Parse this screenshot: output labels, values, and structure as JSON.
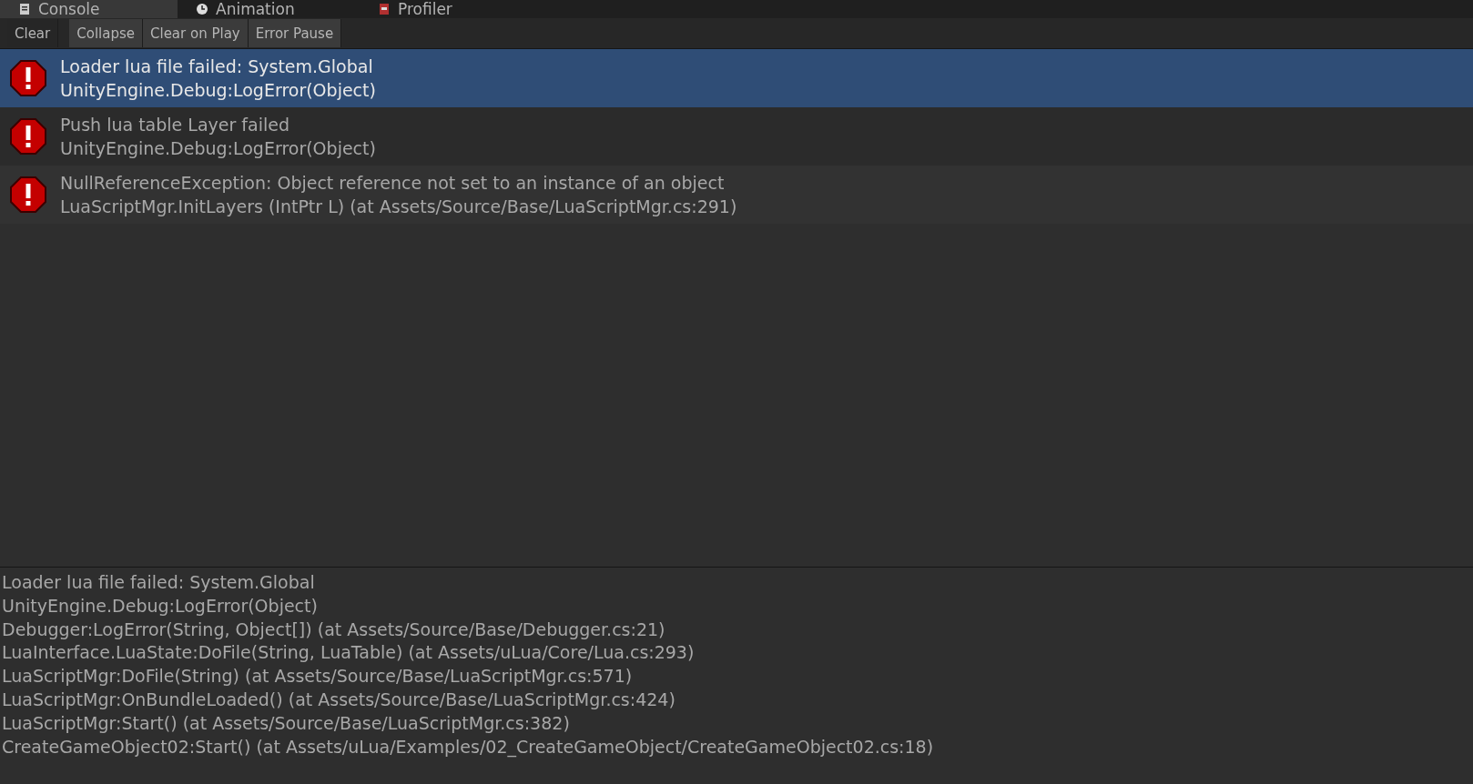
{
  "tabs": [
    {
      "label": "Console",
      "selected": true
    },
    {
      "label": "Animation",
      "selected": false
    },
    {
      "label": "Profiler",
      "selected": false
    }
  ],
  "toolbar": [
    {
      "label": "Clear",
      "kind": "button"
    },
    {
      "label": "Collapse",
      "kind": "toggle"
    },
    {
      "label": "Clear on Play",
      "kind": "toggle"
    },
    {
      "label": "Error Pause",
      "kind": "toggle"
    }
  ],
  "log_entries": [
    {
      "message": "Loader lua file failed: System.Global",
      "source": "UnityEngine.Debug:LogError(Object)",
      "selected": true
    },
    {
      "message": "Push lua table Layer failed",
      "source": "UnityEngine.Debug:LogError(Object)",
      "selected": false
    },
    {
      "message": "NullReferenceException: Object reference not set to an instance of an object",
      "source": "LuaScriptMgr.InitLayers (IntPtr L) (at Assets/Source/Base/LuaScriptMgr.cs:291)",
      "selected": false
    }
  ],
  "details": [
    "Loader lua file failed: System.Global",
    "UnityEngine.Debug:LogError(Object)",
    "Debugger:LogError(String, Object[]) (at Assets/Source/Base/Debugger.cs:21)",
    "LuaInterface.LuaState:DoFile(String, LuaTable) (at Assets/uLua/Core/Lua.cs:293)",
    "LuaScriptMgr:DoFile(String) (at Assets/Source/Base/LuaScriptMgr.cs:571)",
    "LuaScriptMgr:OnBundleLoaded() (at Assets/Source/Base/LuaScriptMgr.cs:424)",
    "LuaScriptMgr:Start() (at Assets/Source/Base/LuaScriptMgr.cs:382)",
    "CreateGameObject02:Start() (at Assets/uLua/Examples/02_CreateGameObject/CreateGameObject02.cs:18)"
  ]
}
